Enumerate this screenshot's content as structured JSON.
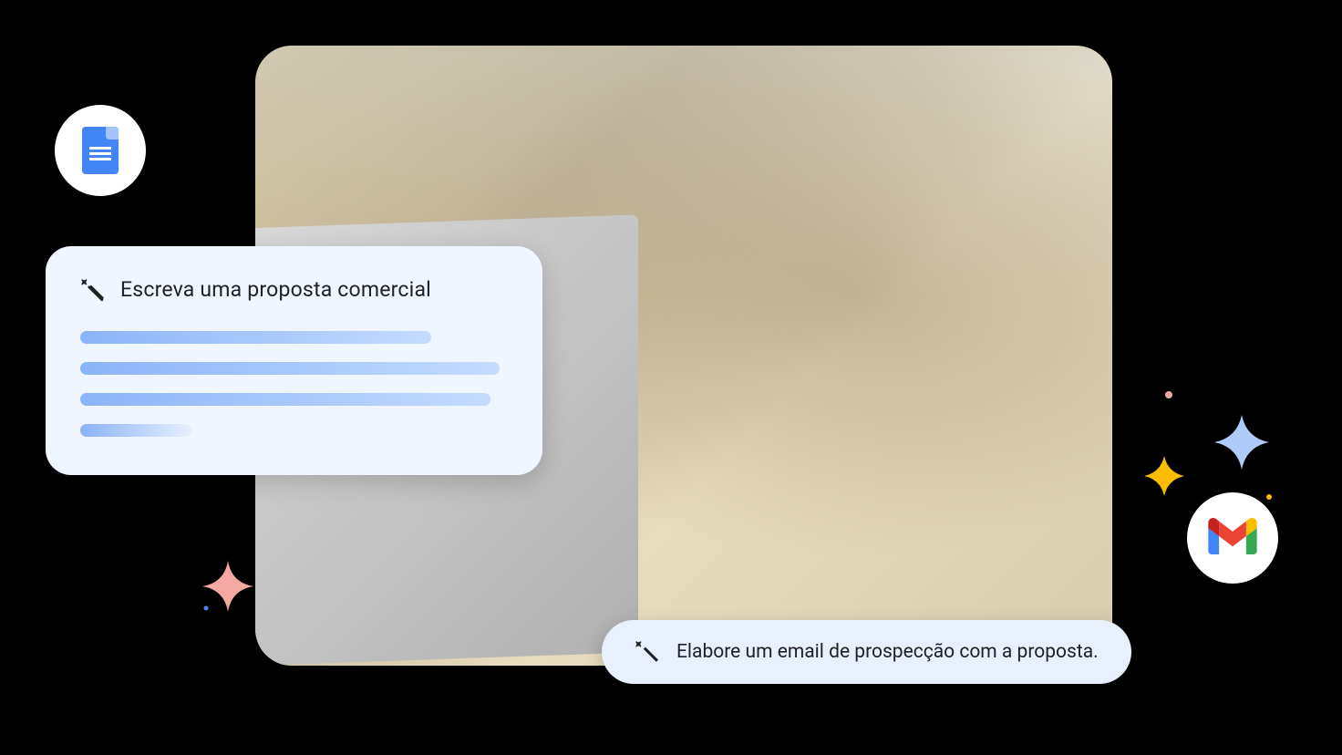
{
  "icons": {
    "docs": "google-docs-icon",
    "gmail": "gmail-icon",
    "magic_wand": "magic-wand-icon"
  },
  "prompt_card": {
    "title": "Escreva uma proposta comercial"
  },
  "prompt_pill": {
    "text": "Elabore um email de prospecção com a proposta."
  },
  "colors": {
    "card_bg": "#f0f6ff",
    "pill_bg": "#e8f0fe",
    "docs_blue": "#4285f4",
    "sparkle_pink": "#f28b82",
    "sparkle_yellow": "#fbbc04",
    "sparkle_blue": "#aecbfa"
  }
}
